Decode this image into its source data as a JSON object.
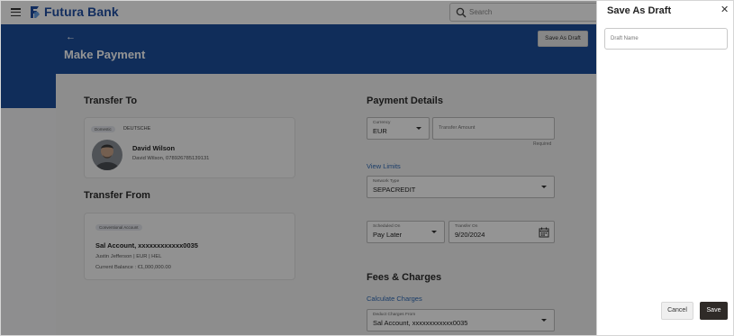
{
  "header": {
    "brand": "Futura Bank",
    "search_placeholder": "Search"
  },
  "banner": {
    "back_arrow": "←",
    "title": "Make Payment",
    "save_as_draft_label": "Save As Draft"
  },
  "transfer_to": {
    "heading": "Transfer To",
    "tag": "Domestic",
    "bank": "DEUTSCHE",
    "payee_name": "David Wilson",
    "payee_detail": "David Wilson, 078926785139131"
  },
  "transfer_from": {
    "heading": "Transfer From",
    "tag": "Conventional Account",
    "account": "Sal Account, xxxxxxxxxxxx0035",
    "holder_line": "Justin Jefferson | EUR | HEL",
    "balance": "Current Balance : €1,000,000.00"
  },
  "payment_details": {
    "heading": "Payment Details",
    "currency_label": "Currency",
    "currency_value": "EUR",
    "amount_placeholder": "Transfer Amount",
    "required_text": "Required",
    "view_limits": "View Limits",
    "network_label": "Network Type",
    "network_value": "SEPACREDIT",
    "scheduled_label": "Scheduled On",
    "scheduled_value": "Pay Later",
    "transfer_on_label": "Transfer On",
    "transfer_on_value": "9/20/2024"
  },
  "fees": {
    "heading": "Fees & Charges",
    "calculate_link": "Calculate Charges",
    "deduct_label": "Deduct Charges From",
    "deduct_value": "Sal Account, xxxxxxxxxxxx0035"
  },
  "draft_panel": {
    "title": "Save As Draft",
    "close": "✕",
    "name_placeholder": "Draft Name",
    "cancel_label": "Cancel",
    "save_label": "Save"
  },
  "colors": {
    "brand_blue": "#1d4f9c",
    "link_blue": "#2f6ab5",
    "save_dark": "#2f2b28"
  },
  "icons": [
    "hamburger-icon",
    "bank-logo-icon",
    "search-icon",
    "back-arrow-icon",
    "chevron-down-icon",
    "calendar-icon",
    "close-icon"
  ]
}
